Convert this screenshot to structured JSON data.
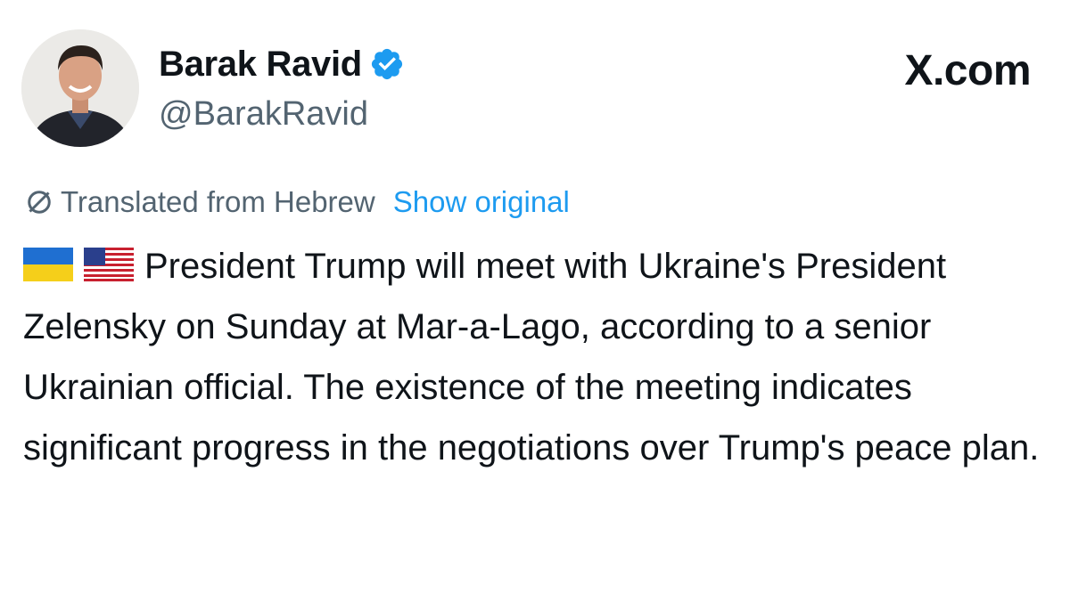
{
  "author": {
    "display_name": "Barak Ravid",
    "handle": "@BarakRavid",
    "verified": true,
    "avatar_icon": "profile-photo"
  },
  "brand": {
    "label": "X.com"
  },
  "translation": {
    "icon": "translate-icon",
    "label": "Translated from Hebrew",
    "show_original_label": "Show original"
  },
  "tweet": {
    "flags": [
      "ukraine-flag",
      "us-flag"
    ],
    "text": "President Trump will meet with Ukraine's President Zelensky on Sunday at Mar-a-Lago, according to a senior Ukrainian official. The existence of the meeting indicates significant progress in the negotiations over Trump's peace plan."
  },
  "colors": {
    "text": "#0f1419",
    "secondary": "#536471",
    "link": "#1d9bf0",
    "verified": "#1d9bf0"
  }
}
